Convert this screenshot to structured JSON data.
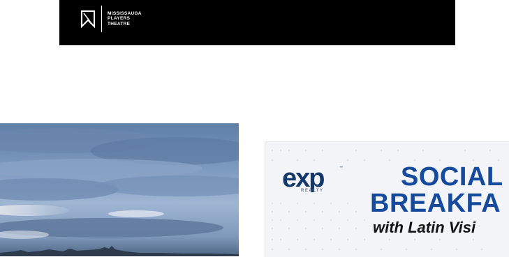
{
  "banner": {
    "logo": {
      "icon": "bookmark-logo-icon",
      "lines": [
        "MISSISSAUGA",
        "PLAYERS",
        "THEATRE"
      ]
    },
    "background": "#000000"
  },
  "photo": {
    "icon": "sky-photo"
  },
  "exp_card": {
    "logo_text": "exp",
    "logo_tm": "™",
    "logo_realty": "REALTY",
    "headline_line1": "SOCIAL",
    "headline_line2": "BREAKFA",
    "subline": "with Latin Visi",
    "colors": {
      "brand_navy": "#13396c",
      "brand_blue": "#1f7ad1",
      "headline_blue": "#164a9c"
    }
  }
}
